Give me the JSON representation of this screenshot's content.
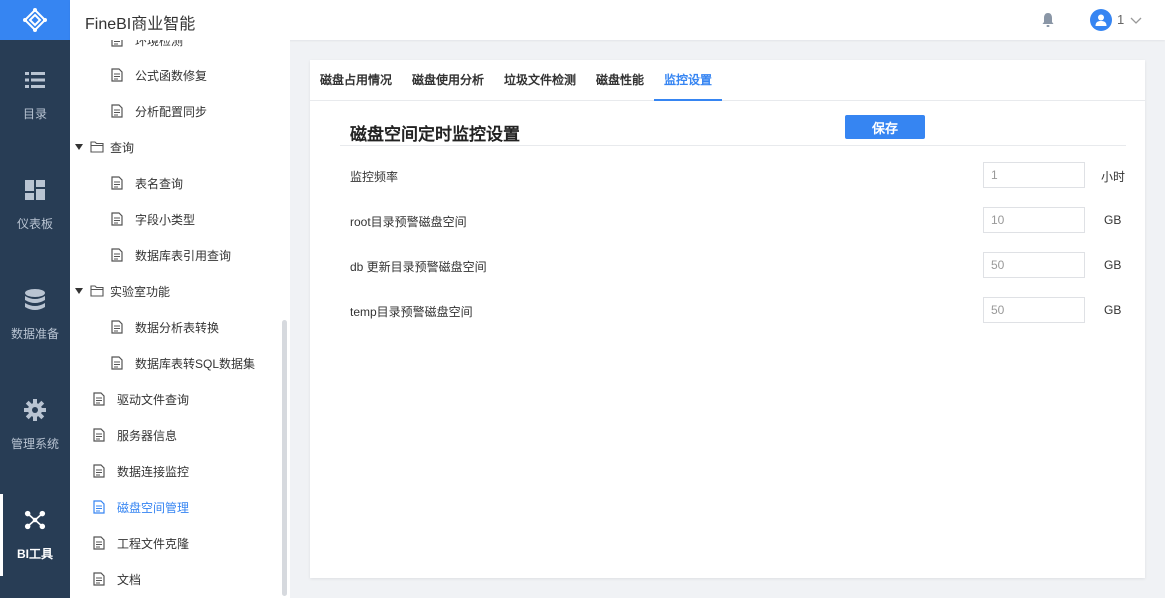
{
  "app": {
    "title": "FineBI商业智能"
  },
  "user": {
    "name": "1"
  },
  "nav": [
    {
      "label": "目录",
      "icon": "list-icon"
    },
    {
      "label": "仪表板",
      "icon": "dashboard-icon"
    },
    {
      "label": "数据准备",
      "icon": "database-icon"
    },
    {
      "label": "管理系统",
      "icon": "gear-icon"
    },
    {
      "label": "BI工具",
      "icon": "network-icon",
      "active": true
    }
  ],
  "tree": [
    {
      "label": "环境检测",
      "level": 2
    },
    {
      "label": "公式函数修复",
      "level": 2
    },
    {
      "label": "分析配置同步",
      "level": 2
    },
    {
      "label": "查询",
      "level": 1,
      "folder": true
    },
    {
      "label": "表名查询",
      "level": 2
    },
    {
      "label": "字段小类型",
      "level": 2
    },
    {
      "label": "数据库表引用查询",
      "level": 2
    },
    {
      "label": "实验室功能",
      "level": 1,
      "folder": true
    },
    {
      "label": "数据分析表转换",
      "level": 2
    },
    {
      "label": "数据库表转SQL数据集",
      "level": 2
    },
    {
      "label": "驱动文件查询",
      "level": 1
    },
    {
      "label": "服务器信息",
      "level": 1
    },
    {
      "label": "数据连接监控",
      "level": 1
    },
    {
      "label": "磁盘空间管理",
      "level": 1,
      "active": true
    },
    {
      "label": "工程文件克隆",
      "level": 1
    },
    {
      "label": "文档",
      "level": 1
    }
  ],
  "tabs": [
    {
      "label": "磁盘占用情况"
    },
    {
      "label": "磁盘使用分析"
    },
    {
      "label": "垃圾文件检测"
    },
    {
      "label": "磁盘性能"
    },
    {
      "label": "监控设置",
      "active": true
    }
  ],
  "settings": {
    "title": "磁盘空间定时监控设置",
    "save_label": "保存",
    "fields": [
      {
        "label": "监控频率",
        "value": "1",
        "unit": "小时"
      },
      {
        "label": "root目录预警磁盘空间",
        "value": "10",
        "unit": "GB"
      },
      {
        "label": "db 更新目录预警磁盘空间",
        "value": "50",
        "unit": "GB"
      },
      {
        "label": "temp目录预警磁盘空间",
        "value": "50",
        "unit": "GB"
      }
    ]
  },
  "colors": {
    "accent": "#3685f2",
    "nav_bg": "#283d55"
  }
}
